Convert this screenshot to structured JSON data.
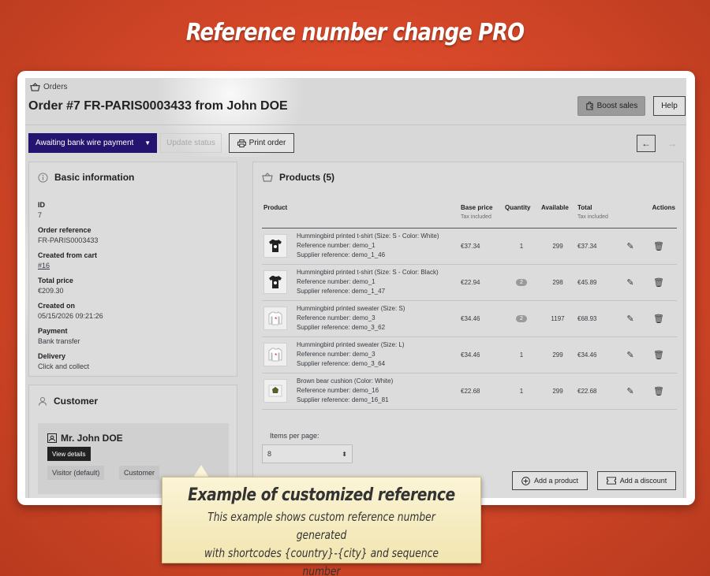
{
  "promo": {
    "title": "Reference number change PRO",
    "callout_title": "Example of customized reference",
    "callout_line1": "This example shows custom reference number generated",
    "callout_line2": "with shortcodes {country}-{city} and sequence number"
  },
  "header": {
    "breadcrumb": "Orders",
    "order_prefix": "Order",
    "order_number": "#7",
    "order_reference": "FR-PARIS0003433",
    "order_suffix": "from John DOE",
    "boost_label": "Boost sales",
    "help_label": "Help"
  },
  "toolbar": {
    "status_value": "Awaiting bank wire payment",
    "update_label": "Update status",
    "print_label": "Print order"
  },
  "basic_info": {
    "title": "Basic information",
    "fields": [
      {
        "label": "ID",
        "value": "7"
      },
      {
        "label": "Order reference",
        "value": "FR-PARIS0003433"
      },
      {
        "label": "Created from cart",
        "value": "#16"
      },
      {
        "label": "Total price",
        "value": "€209.30"
      },
      {
        "label": "Created on",
        "value": "05/15/2026 09:21:26"
      },
      {
        "label": "Payment",
        "value": "Bank transfer"
      },
      {
        "label": "Delivery",
        "value": "Click and collect"
      }
    ]
  },
  "customer": {
    "title": "Customer",
    "name": "Mr. John DOE",
    "view_label": "View details",
    "tags": [
      "Visitor (default)",
      "Customer"
    ]
  },
  "products": {
    "title": "Products (5)",
    "columns": {
      "product": "Product",
      "base_price": "Base price",
      "base_price_sub": "Tax included",
      "quantity": "Quantity",
      "available": "Available",
      "total": "Total",
      "total_sub": "Tax included",
      "actions": "Actions"
    },
    "rows": [
      {
        "name": "Hummingbird printed t-shirt (Size: S - Color: White)",
        "ref": "Reference number: demo_1",
        "supplier": "Supplier reference: demo_1_46",
        "price": "€37.34",
        "qty": "1",
        "qty_badge": false,
        "available": "299",
        "total": "€37.34",
        "thumb": "tshirt"
      },
      {
        "name": "Hummingbird printed t-shirt (Size: S - Color: Black)",
        "ref": "Reference number: demo_1",
        "supplier": "Supplier reference: demo_1_47",
        "price": "€22.94",
        "qty": "2",
        "qty_badge": true,
        "available": "298",
        "total": "€45.89",
        "thumb": "tshirt"
      },
      {
        "name": "Hummingbird printed sweater (Size: S)",
        "ref": "Reference number: demo_3",
        "supplier": "Supplier reference: demo_3_62",
        "price": "€34.46",
        "qty": "2",
        "qty_badge": true,
        "available": "1197",
        "total": "€68.93",
        "thumb": "sweater"
      },
      {
        "name": "Hummingbird printed sweater (Size: L)",
        "ref": "Reference number: demo_3",
        "supplier": "Supplier reference: demo_3_64",
        "price": "€34.46",
        "qty": "1",
        "qty_badge": false,
        "available": "299",
        "total": "€34.46",
        "thumb": "sweater"
      },
      {
        "name": "Brown bear cushion (Color: White)",
        "ref": "Reference number: demo_16",
        "supplier": "Supplier reference: demo_16_81",
        "price": "€22.68",
        "qty": "1",
        "qty_badge": false,
        "available": "299",
        "total": "€22.68",
        "thumb": "cushion"
      }
    ],
    "per_page_label": "Items per page:",
    "per_page_value": "8",
    "add_product_label": "Add a product",
    "add_discount_label": "Add a discount"
  }
}
